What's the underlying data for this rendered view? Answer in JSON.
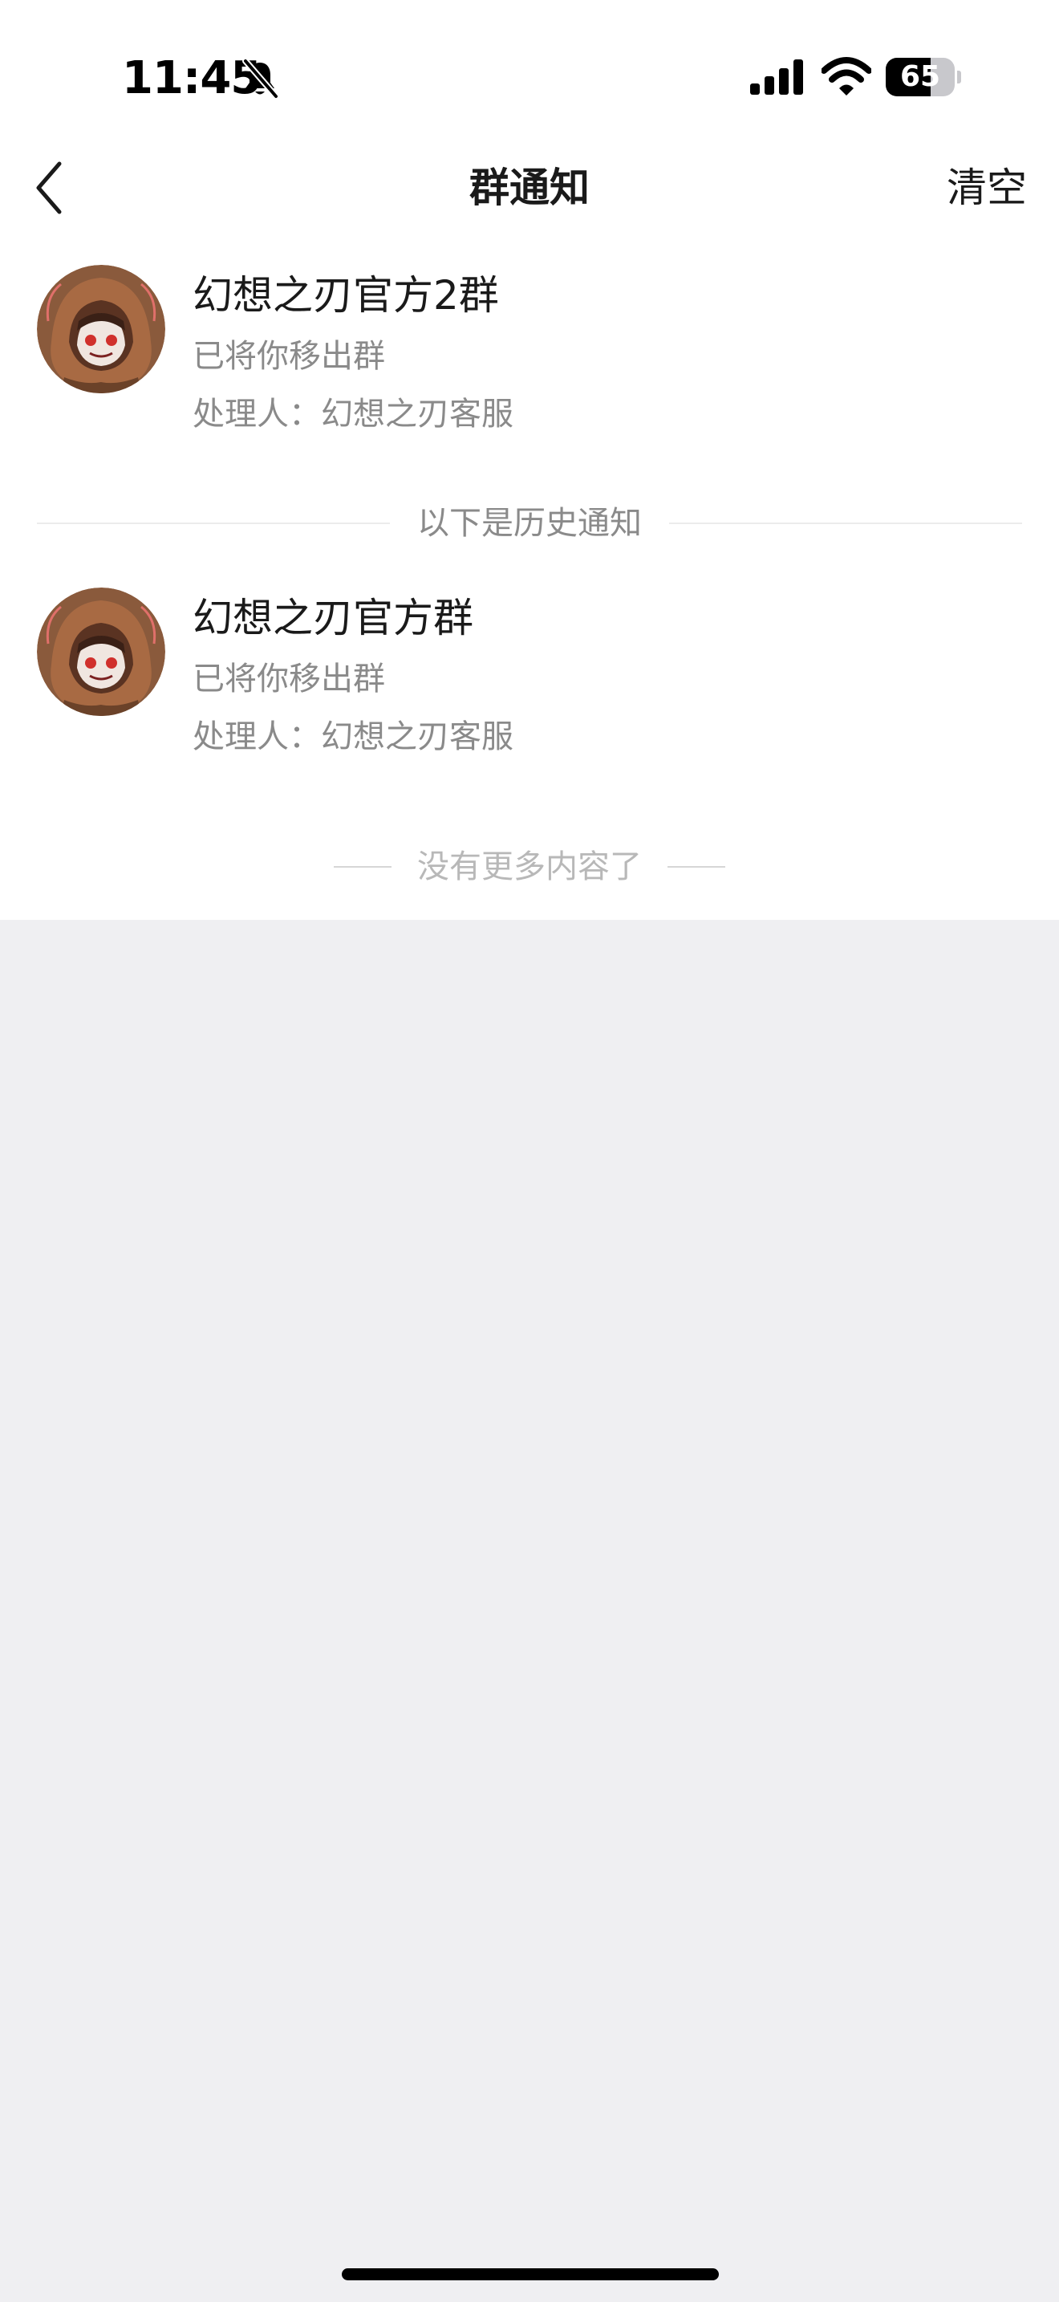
{
  "status_bar": {
    "time": "11:45",
    "battery_level": "65",
    "battery_fraction": 0.65
  },
  "nav": {
    "title": "群通知",
    "clear_label": "清空"
  },
  "notifications": [
    {
      "group_name": "幻想之刃官方2群",
      "message": "已将你移出群",
      "handler_label": "处理人：",
      "handler_name": "幻想之刃客服"
    }
  ],
  "history_divider": "以下是历史通知",
  "history": [
    {
      "group_name": "幻想之刃官方群",
      "message": "已将你移出群",
      "handler_label": "处理人：",
      "handler_name": "幻想之刃客服"
    }
  ],
  "end_text": "没有更多内容了",
  "colors": {
    "page_bg": "#efeff2",
    "card_bg": "#ffffff",
    "primary_text": "#1a1a1a",
    "secondary_text": "#8a8a8a",
    "muted_text": "#b8b8b8"
  },
  "icons": {
    "back": "chevron-left-icon",
    "bell": "bell-slash-icon",
    "signal": "cellular-signal-icon",
    "wifi": "wifi-icon",
    "battery": "battery-icon"
  }
}
